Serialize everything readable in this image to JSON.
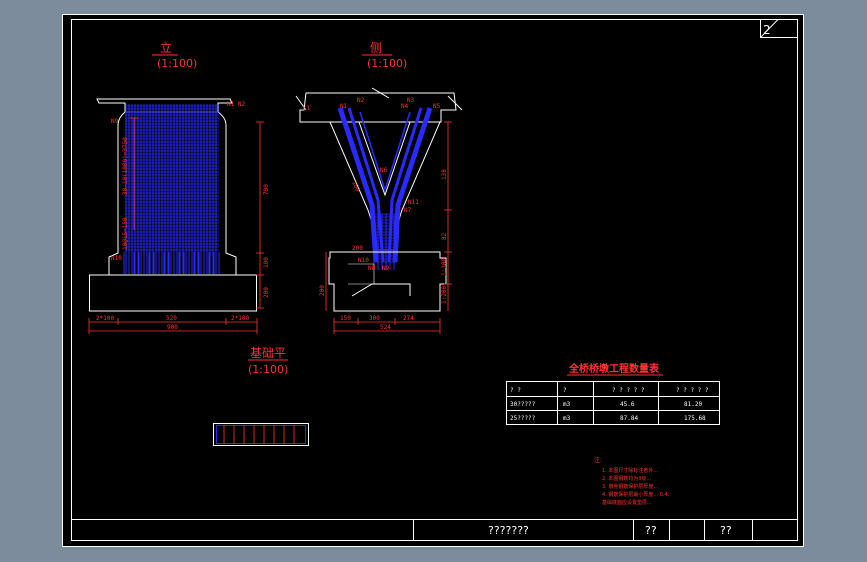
{
  "colors": {
    "background_gray": "#7c8c9c",
    "paper": "#000000",
    "frame": "#ffffff",
    "annotation": "#ff3333",
    "rebar": "#2a2aff",
    "table_border": "#ffffff"
  },
  "sheet_number": "2",
  "elevation_view": {
    "title": "立",
    "scale": "(1:100)"
  },
  "side_view": {
    "title": "侧",
    "scale": "(1:100)"
  },
  "foundation_plan": {
    "title": "基础平",
    "scale": "(1:100)"
  },
  "elevation_labels": {
    "n1n2": "N1 N2",
    "n9": "N9",
    "n10": "N10",
    "rebar_spacing": "38-10(1000)=3750",
    "bottom_spacing": "10@15=150",
    "dim_height": "700",
    "dim_mid": "100",
    "dim_footing": "200",
    "dim_left": "2*100",
    "dim_center": "520",
    "dim_right": "2*100",
    "dim_total": "900"
  },
  "side_labels": {
    "k1": "K1",
    "n1": "N1",
    "n2": "N2",
    "n3": "N3",
    "n4": "N4",
    "n5": "N5",
    "n6": "N6",
    "n7": "N7",
    "n8": "N8",
    "n9": "N9",
    "n10": "N10",
    "n11": "N11",
    "dim_138": "138",
    "dim_82": "82",
    "dim_100": "1:100",
    "dim_200a": "200",
    "dim_200b": "1:200",
    "dim_150": "150",
    "dim_300": "300",
    "dim_274": "274",
    "dim_524": "524",
    "dim_160": "160",
    "dim_200c": "200"
  },
  "quantity_table": {
    "title": "全桥桥墩工程数量表",
    "headers": [
      "?  ?",
      "?",
      "? ? ? ? ?",
      "? ? ? ? ?"
    ],
    "rows": [
      [
        "30?????",
        "m3",
        "45.6",
        "81.20"
      ],
      [
        "25?????",
        "m3",
        "87.84",
        "175.68"
      ]
    ]
  },
  "notes": {
    "heading": "注:",
    "lines": [
      "1. 本图尺寸除标注者外...",
      "2. 本图钢筋均为II级...",
      "3. 墩身钢筋保护层厚度...",
      "4. 钢筋保护层最小厚度...  0.4;",
      "   基础底面应设置垫层..."
    ]
  },
  "title_block": {
    "drawing_name": "???????",
    "cell_a": "??",
    "cell_b": "??"
  }
}
